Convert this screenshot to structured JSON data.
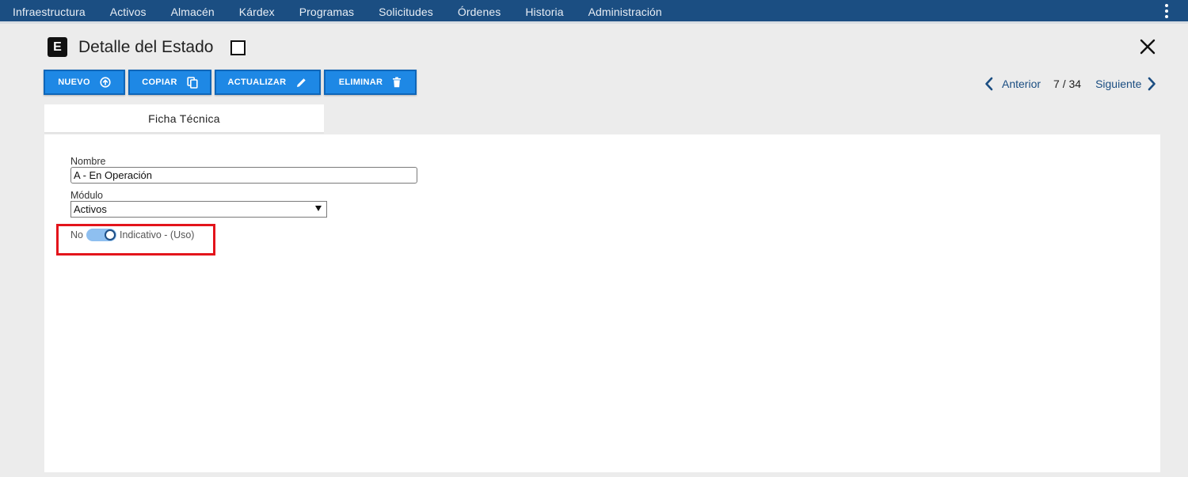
{
  "nav": {
    "items": [
      "Infraestructura",
      "Activos",
      "Almacén",
      "Kárdex",
      "Programas",
      "Solicitudes",
      "Órdenes",
      "Historia",
      "Administración"
    ]
  },
  "header": {
    "logo_letter": "E",
    "title": "Detalle del Estado"
  },
  "toolbar": {
    "nuevo": "NUEVO",
    "copiar": "COPIAR",
    "actualizar": "ACTUALIZAR",
    "eliminar": "ELIMINAR"
  },
  "pager": {
    "prev": "Anterior",
    "count": "7 / 34",
    "next": "Siguiente"
  },
  "tabs": [
    {
      "label": "Ficha Técnica"
    }
  ],
  "form": {
    "nombre_label": "Nombre",
    "nombre_value": "A - En Operación",
    "modulo_label": "Módulo",
    "modulo_value": "Activos",
    "toggle_off_label": "No",
    "toggle_on_label": "Indicativo - (Uso)",
    "toggle_state": true
  },
  "colors": {
    "nav_bg": "#1b4e82",
    "button_bg": "#1e88e5",
    "highlight": "#e3141b",
    "toggle_track": "#8ebff0"
  },
  "icons": {
    "nuevo": "circle-arrow-up-icon",
    "copiar": "copy-icon",
    "actualizar": "pencil-icon",
    "eliminar": "trash-icon",
    "close": "close-icon",
    "prev": "chevron-left-icon",
    "next": "chevron-right-icon",
    "menu": "kebab-menu-icon"
  }
}
